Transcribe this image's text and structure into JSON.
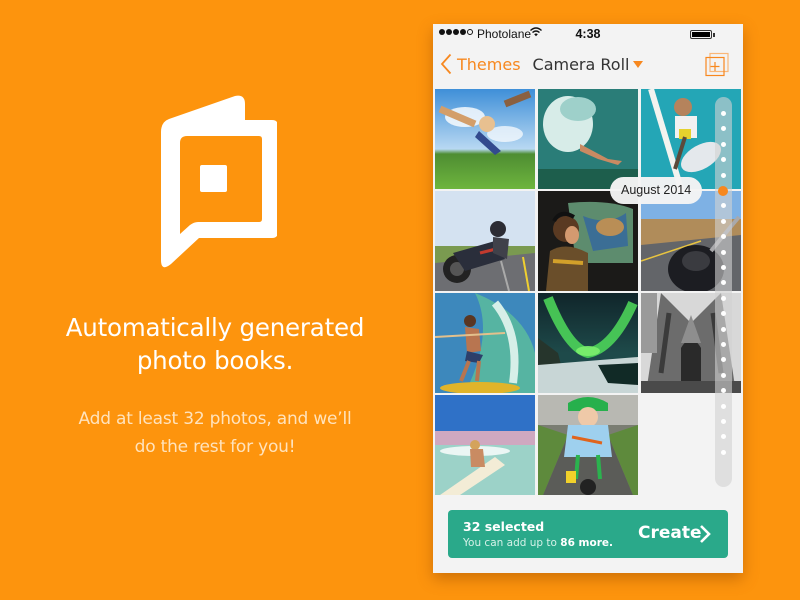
{
  "promo": {
    "headline_line1": "Automatically generated",
    "headline_line2": "photo books.",
    "sub_line1": "Add at least 32 photos, and we’ll",
    "sub_line2": "do the rest for you!",
    "logo_icon": "photo-book-speech-bubble-icon"
  },
  "colors": {
    "background": "#fd940d",
    "accent": "#f7881f",
    "create_bar": "#2aa98a",
    "screen": "#f3f3f3"
  },
  "status_bar": {
    "signal_bars_filled": 4,
    "signal_bars_total": 5,
    "carrier": "Photolane",
    "wifi_icon": "wifi-icon",
    "time": "4:38",
    "battery_icon": "battery-full-icon"
  },
  "nav": {
    "back_label": "Themes",
    "title": "Camera Roll",
    "title_icon": "caret-down-icon",
    "action_icon": "add-album-icon"
  },
  "photos": [
    {
      "subject": "toddler flying over park"
    },
    {
      "subject": "man diving into water"
    },
    {
      "subject": "man climbing sailboat mast"
    },
    {
      "subject": "motorcyclist on road"
    },
    {
      "subject": "woman in helicopter"
    },
    {
      "subject": "motorcycle handlebars on coast road"
    },
    {
      "subject": "surfer riding wave"
    },
    {
      "subject": "northern lights over lake"
    },
    {
      "subject": "gothic cathedral"
    },
    {
      "subject": "woman with surfboard in waves"
    },
    {
      "subject": "child on balance bike"
    }
  ],
  "scrubber": {
    "date_label": "August 2014",
    "tick_count": 23,
    "active_tick_index": 5
  },
  "selection": {
    "count_label": "32 selected",
    "hint_prefix": "You can add up to ",
    "hint_number": "86 more.",
    "create_label": "Create",
    "create_icon": "chevron-right-icon"
  }
}
